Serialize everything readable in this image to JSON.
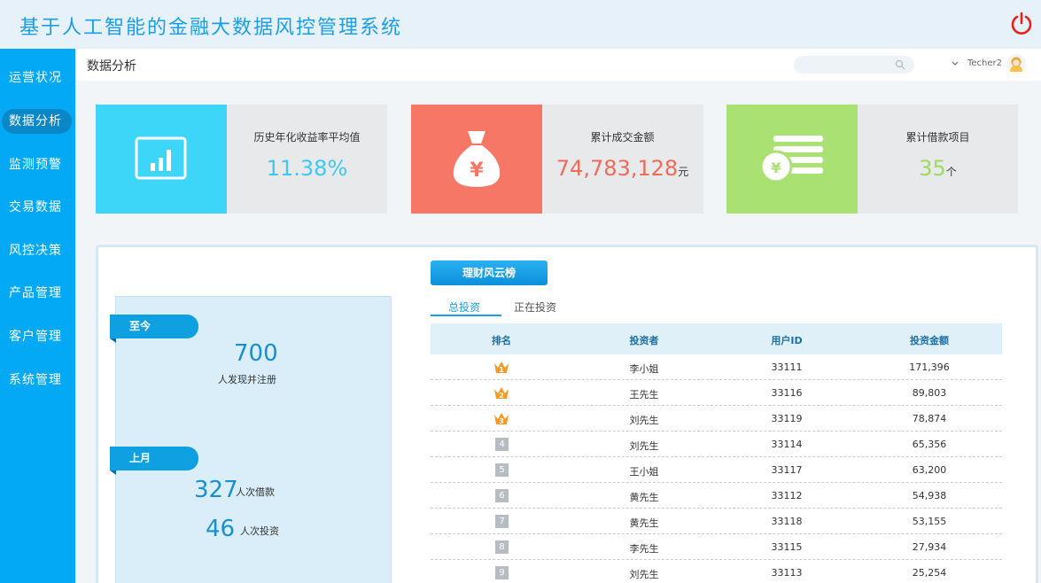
{
  "app": {
    "title": "基于人工智能的金融大数据风控管理系统"
  },
  "colors": {
    "accent": "#03a9f4",
    "power": "#e8221b",
    "card1": "#3dd5f8",
    "card2": "#f77767",
    "card3": "#a9e272"
  },
  "sidebar": {
    "items": [
      {
        "label": "运营状况",
        "active": false
      },
      {
        "label": "数据分析",
        "active": true
      },
      {
        "label": "监测预警",
        "active": false
      },
      {
        "label": "交易数据",
        "active": false
      },
      {
        "label": "风控决策",
        "active": false
      },
      {
        "label": "产品管理",
        "active": false
      },
      {
        "label": "客户管理",
        "active": false
      },
      {
        "label": "系统管理",
        "active": false
      }
    ]
  },
  "header": {
    "page_title": "数据分析",
    "search_placeholder": "",
    "username": "Techer2"
  },
  "stats": [
    {
      "label": "历史年化收益率平均值",
      "value": "11.38%",
      "unit": "",
      "icon": "bar-chart-icon",
      "color": "#3dd5f8"
    },
    {
      "label": "累计成交金额",
      "value": "74,783,128",
      "unit": "元",
      "icon": "money-bag-icon",
      "color": "#f77767"
    },
    {
      "label": "累计借款项目",
      "value": "35",
      "unit": "个",
      "icon": "coins-icon",
      "color": "#a9e272"
    }
  ],
  "summary": {
    "since_label": "至今",
    "registered_value": "700",
    "registered_text": "人发现并注册",
    "lastmonth_label": "上月",
    "borrow_value": "327",
    "borrow_text": "人次借款",
    "invest_value": "46",
    "invest_text": "人次投资"
  },
  "ranking": {
    "button_label": "理财风云榜",
    "tabs": [
      {
        "label": "总投资",
        "active": true
      },
      {
        "label": "正在投资",
        "active": false
      }
    ],
    "columns": [
      "排名",
      "投资者",
      "用户ID",
      "投资金额"
    ],
    "rows": [
      {
        "rank": "1",
        "investor": "李小姐",
        "id": "33111",
        "amount": "171,396"
      },
      {
        "rank": "2",
        "investor": "王先生",
        "id": "33116",
        "amount": "89,803"
      },
      {
        "rank": "3",
        "investor": "刘先生",
        "id": "33119",
        "amount": "78,874"
      },
      {
        "rank": "4",
        "investor": "刘先生",
        "id": "33114",
        "amount": "65,356"
      },
      {
        "rank": "5",
        "investor": "王小姐",
        "id": "33117",
        "amount": "63,200"
      },
      {
        "rank": "6",
        "investor": "黄先生",
        "id": "33112",
        "amount": "54,938"
      },
      {
        "rank": "7",
        "investor": "黄先生",
        "id": "33118",
        "amount": "53,155"
      },
      {
        "rank": "8",
        "investor": "李先生",
        "id": "33115",
        "amount": "27,934"
      },
      {
        "rank": "9",
        "investor": "刘先生",
        "id": "33113",
        "amount": "25,254"
      }
    ]
  }
}
